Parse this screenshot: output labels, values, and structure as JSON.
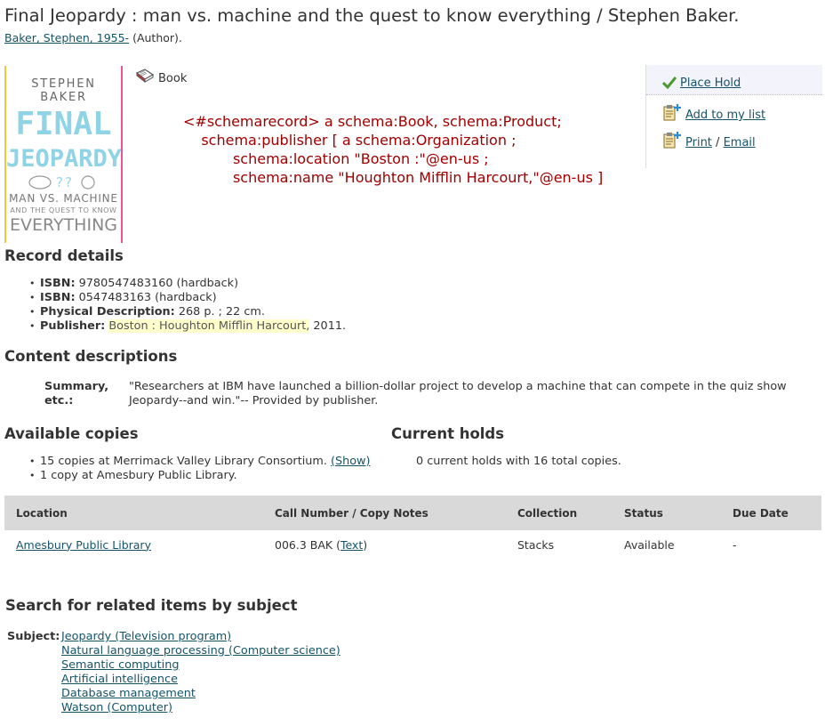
{
  "record": {
    "title": "Final Jeopardy : man vs. machine and the quest to know everything / Stephen Baker.",
    "author_link": "Baker, Stephen, 1955-",
    "author_role": "(Author).",
    "format": "Book"
  },
  "cover": {
    "author": "STEPHEN BAKER",
    "line1": "FINAL",
    "line2": "JEOPARDY",
    "qmarks": "?‍?",
    "line3": "MAN VS. MACHINE",
    "line4": "AND THE QUEST TO KNOW",
    "line5": "EVERYTHING"
  },
  "schema_text": "<#schemarecord> a schema:Book, schema:Product;\n    schema:publisher [ a schema:Organization ;\n           schema:location \"Boston :\"@en-us ;\n           schema:name \"Houghton Mifflin Harcourt,\"@en-us ]",
  "actions": {
    "place_hold": "Place Hold",
    "add_to_list": "Add to my list",
    "print": "Print",
    "separator": "/",
    "email": "Email"
  },
  "record_details": {
    "heading": "Record details",
    "items": [
      {
        "label": "ISBN:",
        "value": "9780547483160 (hardback)"
      },
      {
        "label": "ISBN:",
        "value": "0547483163 (hardback)"
      },
      {
        "label": "Physical Description:",
        "value": "268 p. ; 22 cm."
      },
      {
        "label": "Publisher:",
        "value_highlight": "Boston : Houghton Mifflin Harcourt,",
        "value": "2011."
      }
    ]
  },
  "content_descriptions": {
    "heading": "Content descriptions",
    "summary_label": "Summary, etc.:",
    "summary_text": "\"Researchers at IBM have launched a billion-dollar project to develop a machine that can compete in the quiz show Jeopardy--and win.\"-- Provided by publisher."
  },
  "available_copies": {
    "heading": "Available copies",
    "items": [
      {
        "text": "15 copies at Merrimack Valley Library Consortium.",
        "link": "(Show)"
      },
      {
        "text": "1 copy at Amesbury Public Library."
      }
    ]
  },
  "current_holds": {
    "heading": "Current holds",
    "text": "0 current holds with 16 total copies."
  },
  "copies_table": {
    "columns": [
      "Location",
      "Call Number / Copy Notes",
      "Collection",
      "Status",
      "Due Date"
    ],
    "rows": [
      {
        "location": "Amesbury Public Library",
        "call_number": "006.3 BAK",
        "call_link": "Text",
        "collection": "Stacks",
        "status": "Available",
        "due": "-"
      }
    ]
  },
  "related": {
    "heading": "Search for related items by subject",
    "subject_label": "Subject:",
    "subjects": [
      "Jeopardy (Television program)",
      "Natural language processing (Computer science)",
      "Semantic computing",
      "Artificial intelligence",
      "Database management",
      "Watson (Computer)"
    ]
  },
  "colors": {
    "link": "#155467",
    "schema_text": "#a00000",
    "table_header": "#d9d9d9",
    "highlight": "#ffffcc",
    "check": "#4a9b2e"
  }
}
